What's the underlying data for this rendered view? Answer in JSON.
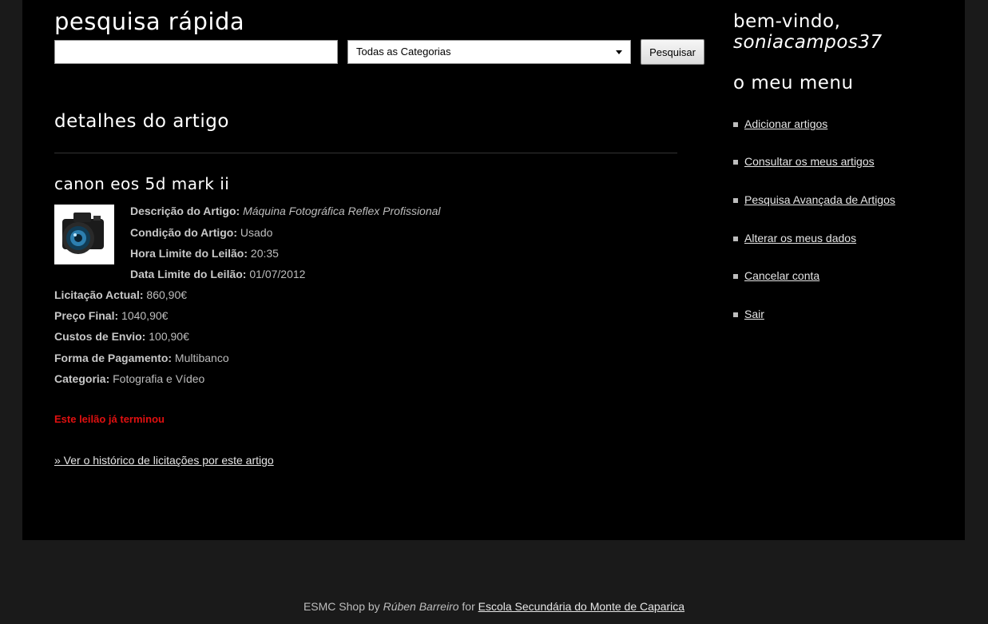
{
  "search": {
    "title": "pesquisa rápida",
    "input_value": "",
    "category_selected": "Todas as Categorias",
    "button_label": "Pesquisar"
  },
  "details": {
    "title": "detalhes do artigo",
    "item_name": "canon eos 5d mark ii",
    "image_icon": "camera-photo",
    "fields": [
      {
        "label": "Descrição do Artigo:",
        "value": "Máquina Fotográfica Reflex Profissional"
      },
      {
        "label": "Condição do Artigo:",
        "value": "Usado"
      },
      {
        "label": "Hora Limite do Leilão:",
        "value": "20:35"
      },
      {
        "label": "Data Limite do Leilão:",
        "value": "01/07/2012"
      },
      {
        "label": "Licitação Actual:",
        "value": "860,90€"
      },
      {
        "label": "Preço Final:",
        "value": "1040,90€"
      },
      {
        "label": "Custos de Envio:",
        "value": "100,90€"
      },
      {
        "label": "Forma de Pagamento:",
        "value": "Multibanco"
      },
      {
        "label": "Categoria:",
        "value": "Fotografia e Vídeo"
      }
    ],
    "ended_message": "Este leilão já terminou",
    "history_link": "» Ver o histórico de licitações por este artigo"
  },
  "sidebar": {
    "welcome": "bem-vindo,",
    "username": "soniacampos37",
    "menu_title": "o meu menu",
    "items": [
      {
        "label": "Adicionar artigos"
      },
      {
        "label": "Consultar os meus artigos"
      },
      {
        "label": "Pesquisa Avançada de Artigos"
      },
      {
        "label": "Alterar os meus dados"
      },
      {
        "label": "Cancelar conta"
      },
      {
        "label": "Sair"
      }
    ]
  },
  "footer": {
    "shop": "ESMC Shop by ",
    "author": "Rúben Barreiro",
    "for": " for ",
    "school": "Escola Secundária do Monte de Caparica"
  },
  "colors": {
    "background": "#1a1a1a",
    "panel": "#000000",
    "alert": "#e01010"
  }
}
